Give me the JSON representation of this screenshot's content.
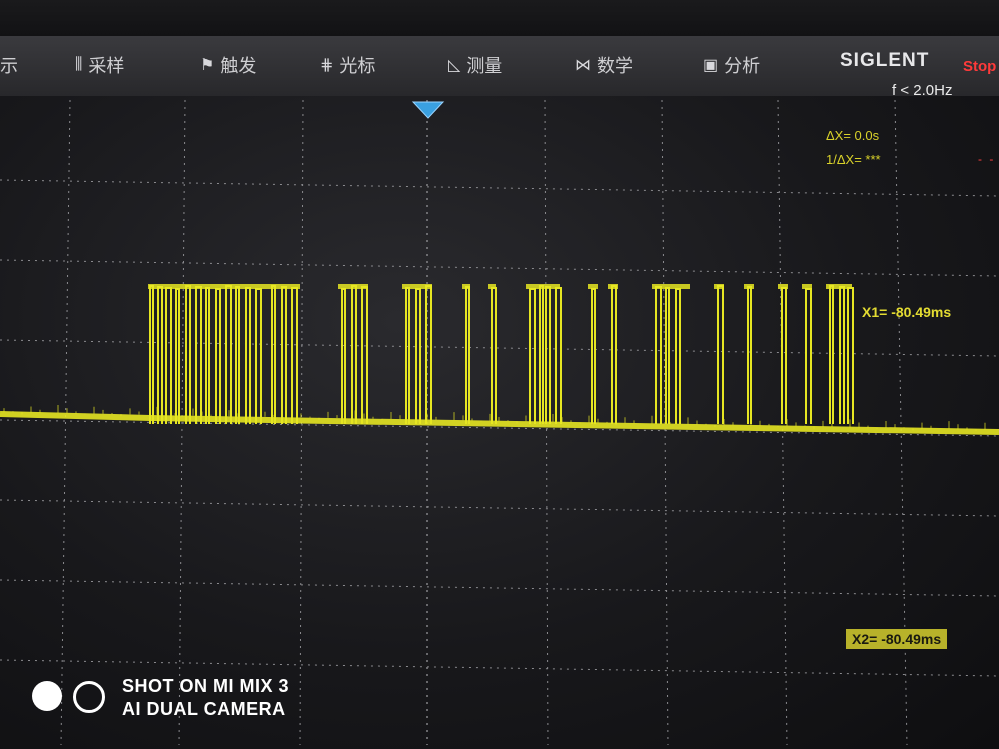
{
  "menu": [
    {
      "label": "示",
      "icon": ""
    },
    {
      "label": "采样",
      "icon": "sampling-icon"
    },
    {
      "label": "触发",
      "icon": "trigger-flag-icon"
    },
    {
      "label": "光标",
      "icon": "cursor-icon"
    },
    {
      "label": "测量",
      "icon": "measure-icon"
    },
    {
      "label": "数学",
      "icon": "math-icon"
    },
    {
      "label": "分析",
      "icon": "analysis-icon"
    }
  ],
  "brand": "SIGLENT",
  "status": "Stop",
  "frequency": "f < 2.0Hz",
  "cursor": {
    "delta_x": "ΔX= 0.0s",
    "inv_delta_x": "1/ΔX= ***",
    "x1": "X1= -80.49ms",
    "x2": "X2= -80.49ms"
  },
  "watermark": {
    "line1": "SHOT ON MI MIX 3",
    "line2": "AI DUAL CAMERA"
  },
  "colors": {
    "trace": "#e6e622",
    "grid": "#8a8a8e",
    "status": "#ff3a3a"
  }
}
